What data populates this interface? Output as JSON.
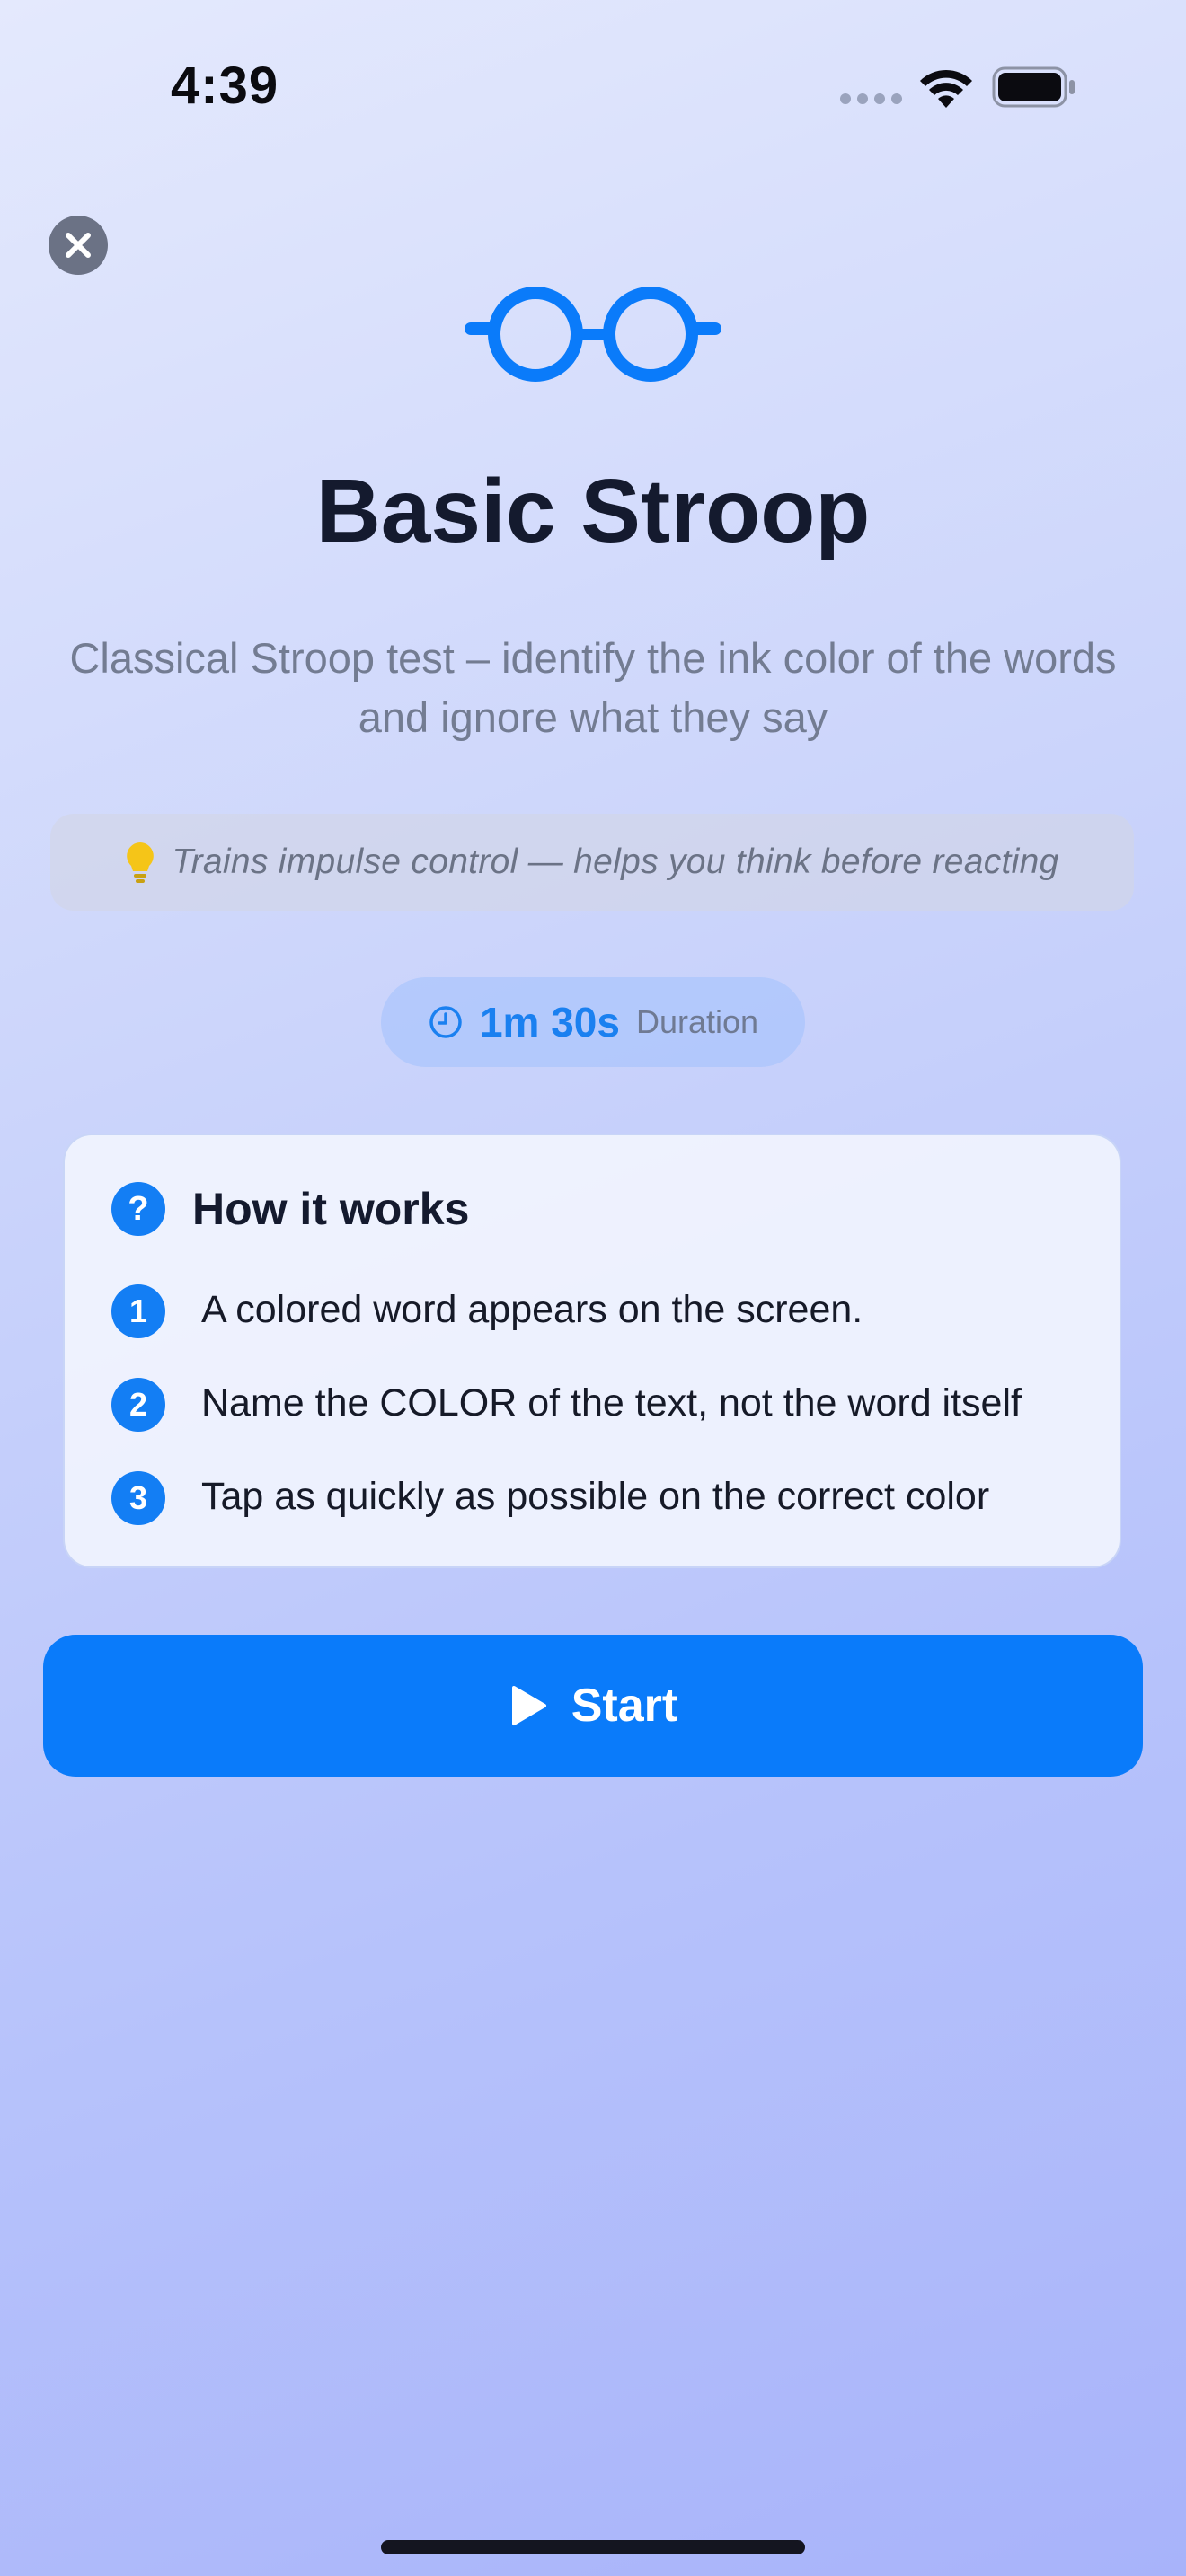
{
  "status_bar": {
    "time": "4:39"
  },
  "icons": {
    "close": "close-icon",
    "hero": "glasses-icon",
    "tip": "lightbulb-icon",
    "duration": "clock-icon",
    "help": "question-icon",
    "start": "play-icon"
  },
  "hero": {
    "title": "Basic Stroop",
    "subtitle": "Classical Stroop test – identify the ink color of the words and ignore what they say"
  },
  "tip": {
    "text": "Trains impulse control — helps you think before reacting"
  },
  "duration": {
    "value": "1m 30s",
    "label": "Duration"
  },
  "how_it_works": {
    "help_glyph": "?",
    "title": "How it works",
    "steps": [
      {
        "number": "1",
        "text": "A colored word appears on the screen."
      },
      {
        "number": "2",
        "text": "Name the COLOR of the text, not the word itself"
      },
      {
        "number": "3",
        "text": "Tap as quickly as possible on the correct color"
      }
    ]
  },
  "actions": {
    "start_label": "Start"
  },
  "colors": {
    "accent": "#0a7bfa",
    "title": "#141a2e",
    "muted": "#737c92"
  }
}
